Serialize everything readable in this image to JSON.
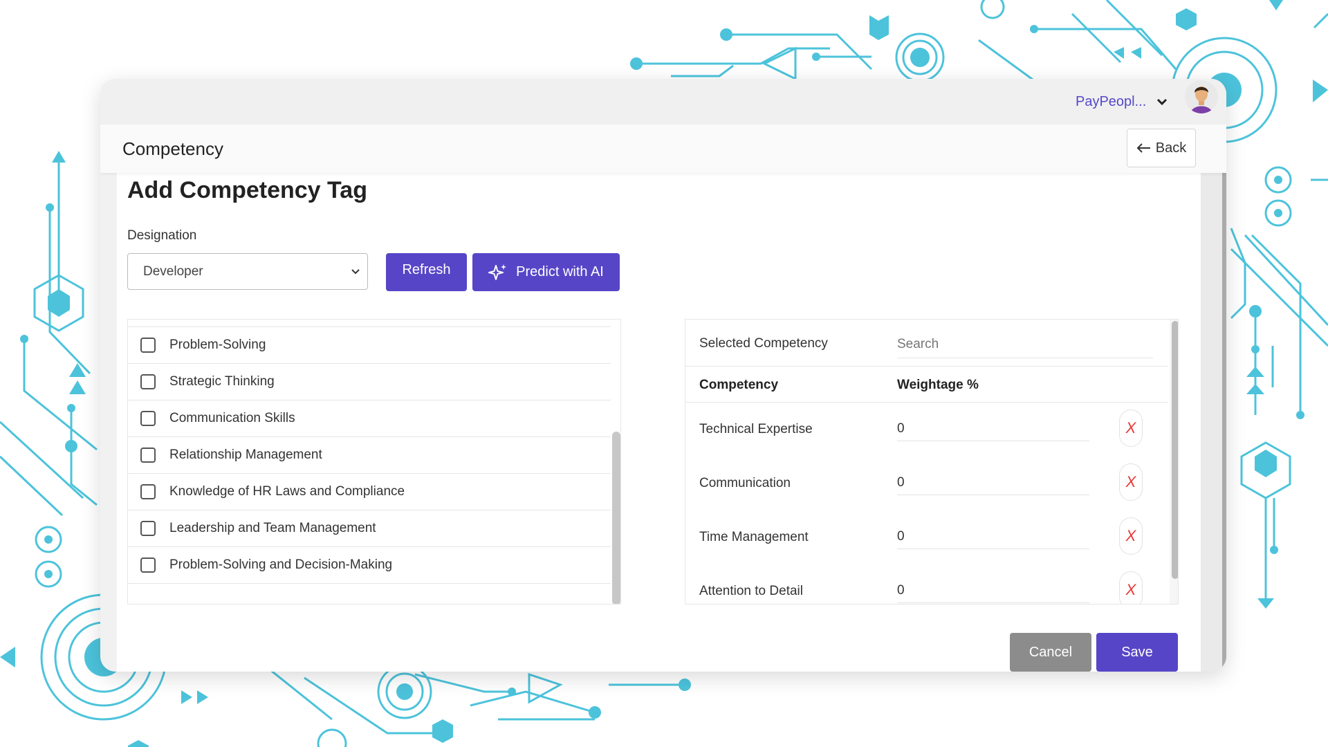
{
  "header": {
    "org_name": "PayPeopl...",
    "page_title": "Competency",
    "back_label": "Back"
  },
  "form": {
    "title": "Add Competency Tag",
    "designation_label": "Designation",
    "designation_value": "Developer",
    "refresh_label": "Refresh",
    "predict_label": "Predict with AI"
  },
  "competency_list": [
    {
      "label": "Problem-Solving",
      "checked": false
    },
    {
      "label": "Strategic Thinking",
      "checked": false
    },
    {
      "label": "Communication Skills",
      "checked": false
    },
    {
      "label": "Relationship Management",
      "checked": false
    },
    {
      "label": "Knowledge of HR Laws and Compliance",
      "checked": false
    },
    {
      "label": "Leadership and Team Management",
      "checked": false
    },
    {
      "label": "Problem-Solving and Decision-Making",
      "checked": false
    }
  ],
  "selected": {
    "heading": "Selected Competency",
    "search_placeholder": "Search",
    "col_competency": "Competency",
    "col_weightage": "Weightage %",
    "remove_symbol": "X",
    "rows": [
      {
        "name": "Technical Expertise",
        "weightage": "0"
      },
      {
        "name": "Communication",
        "weightage": "0"
      },
      {
        "name": "Time Management",
        "weightage": "0"
      },
      {
        "name": "Attention to Detail",
        "weightage": "0"
      }
    ]
  },
  "actions": {
    "cancel_label": "Cancel",
    "save_label": "Save"
  },
  "colors": {
    "primary": "#5646c7",
    "org_text": "#5448c8",
    "cancel": "#8c8c8c",
    "remove": "#e53935",
    "circuit": "#4cc3db"
  }
}
